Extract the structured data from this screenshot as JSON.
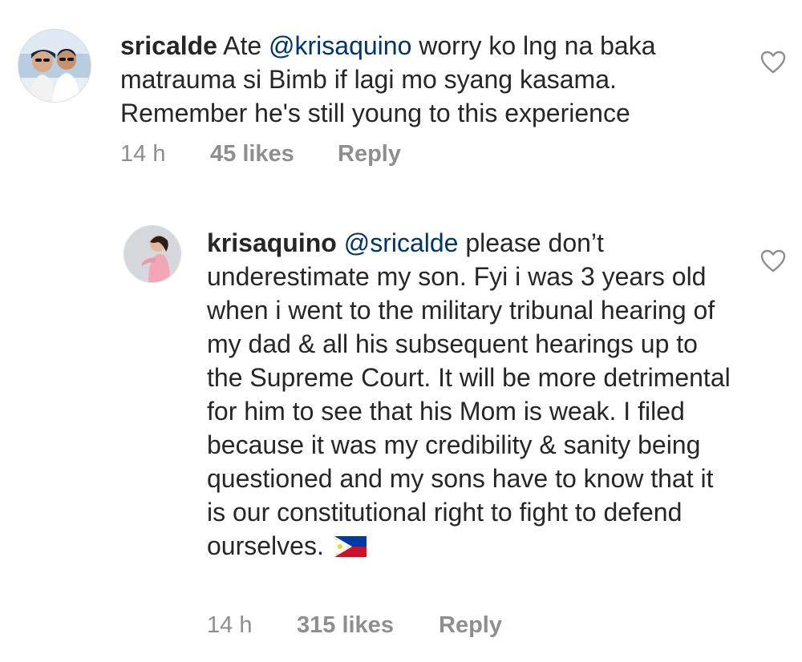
{
  "comments": [
    {
      "username": "sricalde",
      "mention": "@krisaquino",
      "text_before": " Ate ",
      "text_after": " worry ko lng na baka matrauma si Bimb if lagi mo syang kasama. Remember he's still young to this experience",
      "time": "14 h",
      "likes": "45 likes",
      "reply_label": "Reply",
      "avatar_icon": "couple-photo-avatar",
      "like_icon": "heart-outline-icon"
    },
    {
      "username": "krisaquino",
      "mention": "@sricalde",
      "text_after": " please don’t underestimate my son. Fyi i was 3 years old when i went to the military tribunal hearing of my dad & all his subsequent hearings up to the Supreme Court. It will be more detrimental for him to see that his Mom is weak. I filed because it was my credibility & sanity being questioned and my sons have to know that it is our constitutional right to fight to defend ourselves. ",
      "flag_icon": "philippines-flag-emoji",
      "time": "14 h",
      "likes": "315 likes",
      "reply_label": "Reply",
      "avatar_icon": "woman-pink-dress-avatar",
      "like_icon": "heart-outline-icon"
    }
  ],
  "colors": {
    "text": "#262626",
    "mention": "#003569",
    "meta": "#8e8e8e",
    "heart_stroke": "#8e8e8e"
  }
}
